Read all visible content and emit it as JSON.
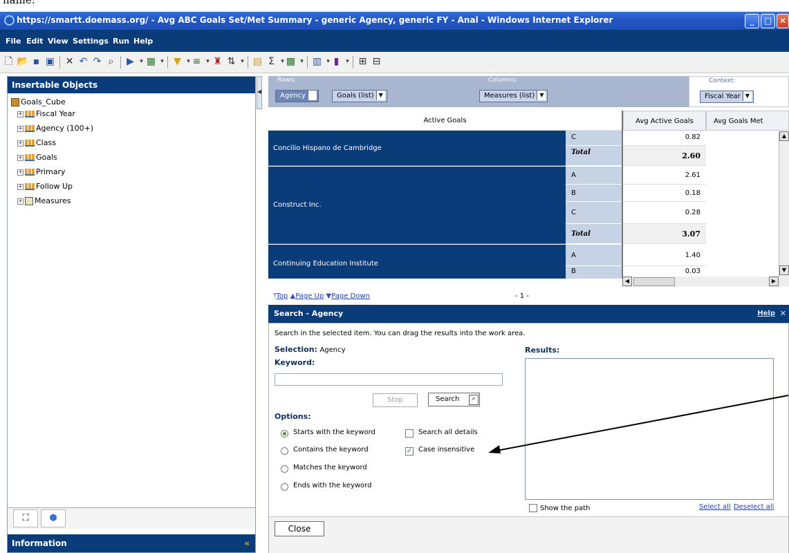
{
  "caption": "name:",
  "window": {
    "title": "https://smartt.doemass.org/ - Avg ABC Goals Set/Met Summary - generic Agency, generic FY - Anal - Windows Internet Explorer",
    "minimize": "_",
    "maximize": "□",
    "close": "✕"
  },
  "menu": [
    "File",
    "Edit",
    "View",
    "Settings",
    "Run",
    "Help"
  ],
  "left_panel": {
    "title": "Insertable Objects",
    "root": "Goals_Cube",
    "items": [
      "Fiscal Year",
      "Agency (100+)",
      "Class",
      "Goals",
      "Primary",
      "Follow Up",
      "Measures"
    ],
    "tab_icons": [
      "tree-icon",
      "package-icon"
    ],
    "info_title": "Information",
    "info_collapse": "«"
  },
  "dropzones": {
    "rows_label": "Rows:",
    "rows": [
      "Agency",
      "Goals (list)"
    ],
    "columns_label": "Columns:",
    "columns": [
      "Measures (list)"
    ],
    "context_label": "Context:",
    "context": [
      "Fiscal Year"
    ]
  },
  "grid": {
    "corner": "Active Goals",
    "columns": [
      "Avg Active Goals",
      "Avg Goals Met"
    ],
    "groups": [
      {
        "agency": "Concilio Hispano de Cambridge",
        "rows": [
          {
            "label": "C",
            "value": "0.82"
          },
          {
            "label": "Total",
            "value": "2.60"
          }
        ]
      },
      {
        "agency": "Construct Inc.",
        "rows": [
          {
            "label": "A",
            "value": "2.61"
          },
          {
            "label": "B",
            "value": "0.18"
          },
          {
            "label": "C",
            "value": "0.28"
          },
          {
            "label": "Total",
            "value": "3.07"
          }
        ]
      },
      {
        "agency": "Continuing Education Institute",
        "rows": [
          {
            "label": "A",
            "value": "1.40"
          },
          {
            "label": "B",
            "value": "0.03"
          }
        ]
      }
    ]
  },
  "pager": {
    "top": "Top",
    "page_up": "Page Up",
    "page_down": "Page Down",
    "page_number": "- 1 -"
  },
  "search": {
    "title": "Search - Agency",
    "help": "Help",
    "instructions": "Search in the selected item. You can drag the results into the work area.",
    "selection_label": "Selection:",
    "selection_value": "Agency",
    "keyword_label": "Keyword:",
    "keyword_value": "",
    "stop": "Stop",
    "search": "Search",
    "options_label": "Options:",
    "match_options": [
      {
        "label": "Starts with the keyword",
        "checked": true
      },
      {
        "label": "Contains the keyword",
        "checked": false
      },
      {
        "label": "Matches the keyword",
        "checked": false
      },
      {
        "label": "Ends with the keyword",
        "checked": false
      }
    ],
    "search_all_details": "Search all details",
    "case_insensitive": "Case insensitive",
    "case_insensitive_checked": true,
    "results_label": "Results:",
    "show_path": "Show the path",
    "select_all": "Select all",
    "deselect_all": "Deselect all",
    "close": "Close"
  }
}
